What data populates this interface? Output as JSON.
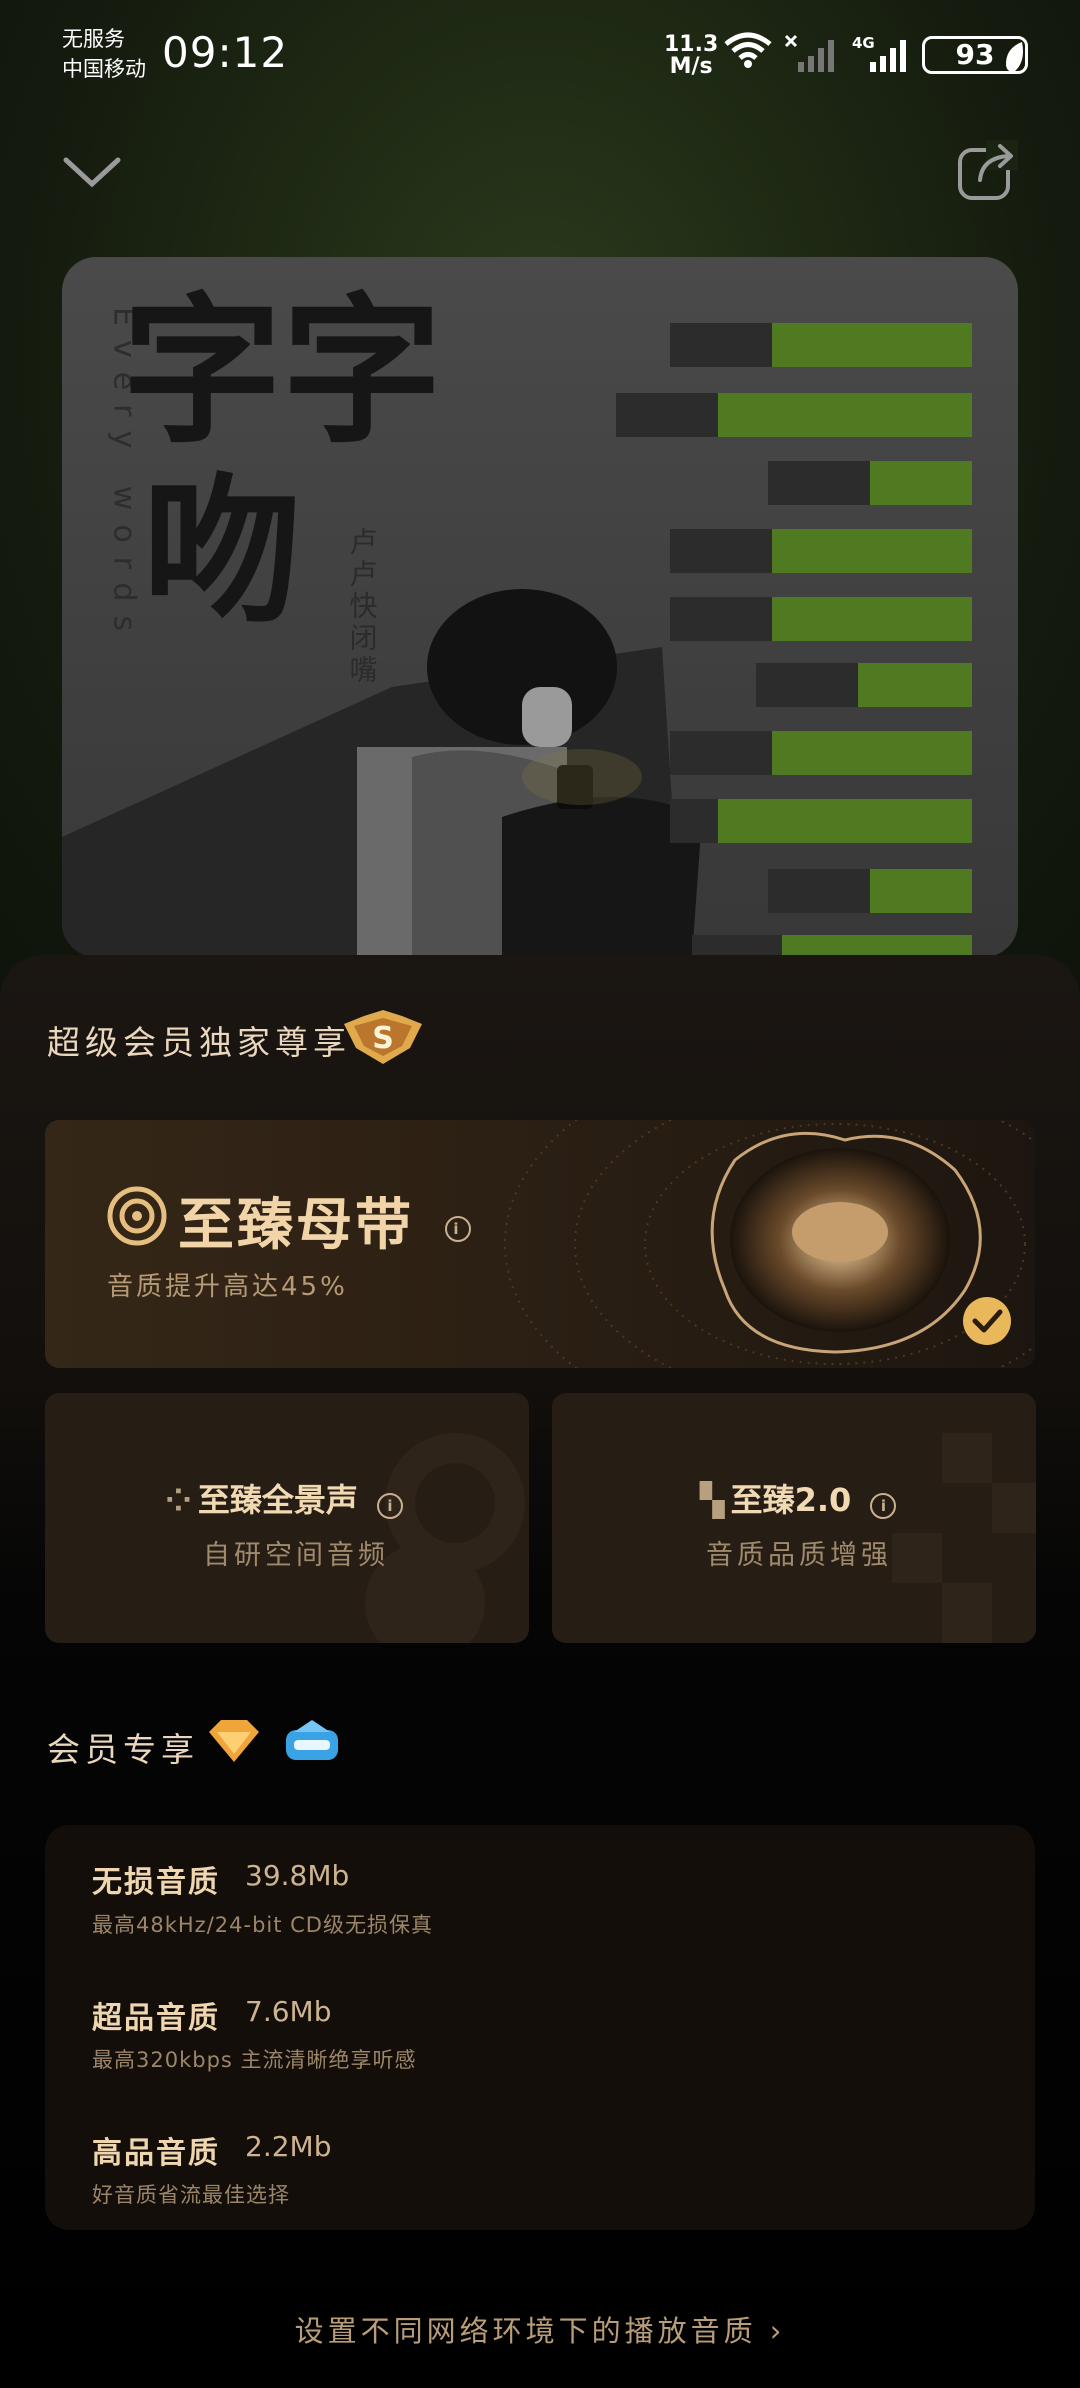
{
  "status_bar": {
    "carrier_line1": "无服务",
    "carrier_line2": "中国移动",
    "time": "09:12",
    "speed_value": "11.3",
    "speed_unit": "M/s",
    "network": "4G",
    "battery": "93"
  },
  "cover": {
    "title": "字字吻",
    "artist": "卢卢快闭嘴",
    "subtitle_vertical": "Every words"
  },
  "sheet": {
    "section1_title": "超级会员独家尊享",
    "hero": {
      "title": "至臻母带",
      "subtitle": "音质提升高达45%",
      "selected": true
    },
    "cards": [
      {
        "title": "至臻全景声",
        "subtitle": "自研空间音频"
      },
      {
        "title": "至臻2.0",
        "subtitle": "音质品质增强"
      }
    ],
    "section2_title": "会员专享",
    "qualities": [
      {
        "name": "无损音质",
        "size": "39.8Mb",
        "desc": "最高48kHz/24-bit CD级无损保真"
      },
      {
        "name": "超品音质",
        "size": "7.6Mb",
        "desc": "最高320kbps 主流清晰绝享听感"
      },
      {
        "name": "高品音质",
        "size": "2.2Mb",
        "desc": "好音质省流最佳选择"
      }
    ],
    "footer_link": "设置不同网络环境下的播放音质"
  },
  "colors": {
    "accent_gold": "#e9b85a",
    "green_bar": "#4f7a21"
  }
}
